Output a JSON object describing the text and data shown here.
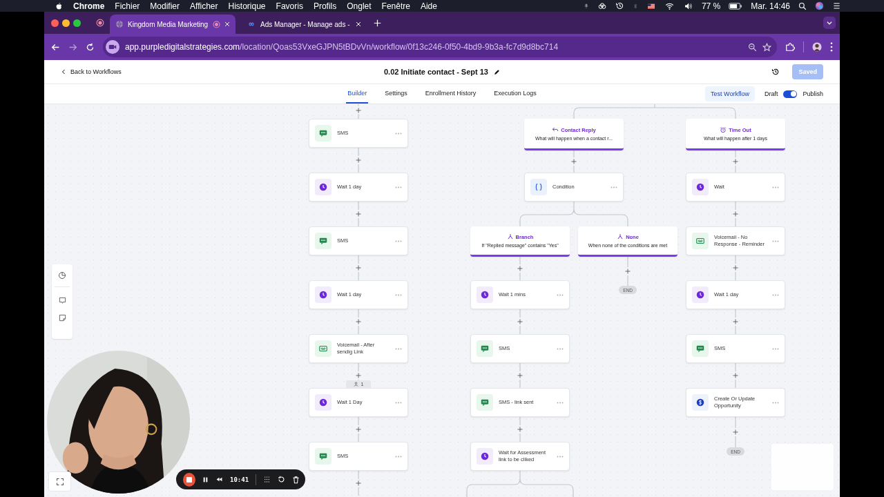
{
  "menu_bar": {
    "app": "Chrome",
    "menus": [
      "Fichier",
      "Modifier",
      "Afficher",
      "Historique",
      "Favoris",
      "Profils",
      "Onglet",
      "Fenêtre",
      "Aide"
    ],
    "battery": "77 %",
    "clock": "Mar. 14:46"
  },
  "browser": {
    "tabs": [
      {
        "title": "Kingdom Media Marketing",
        "selected": true,
        "recording": true,
        "kind": "globe"
      },
      {
        "title": "Ads Manager - Manage ads -",
        "selected": false,
        "recording": false,
        "kind": "meta"
      }
    ],
    "url": {
      "host": "app.purpledigitalstrategies.com",
      "path": "/location/Qoas53VxeGJPN5tBDvVn/workflow/0f13c246-0f50-4bd9-9b3a-fc7d9d8bc714"
    }
  },
  "header": {
    "back": "Back to Workflows",
    "title": "0.02 Initiate contact - Sept 13",
    "save_button": {
      "label": "Saved",
      "disabled": true
    }
  },
  "nav": {
    "tabs": [
      {
        "label": "Builder",
        "selected": true
      },
      {
        "label": "Settings",
        "selected": false
      },
      {
        "label": "Enrollment History",
        "selected": false
      },
      {
        "label": "Execution Logs",
        "selected": false
      }
    ],
    "test_button": "Test Workflow",
    "toggle": {
      "off_label": "Draft",
      "on_label": "Publish",
      "on": true
    }
  },
  "workflow": {
    "main_path": [
      {
        "kind": "sms",
        "label": "SMS"
      },
      {
        "kind": "wait",
        "label": "Wait 1 day"
      },
      {
        "kind": "sms",
        "label": "SMS"
      },
      {
        "kind": "wait",
        "label": "Wait 1 day"
      },
      {
        "kind": "voicemail",
        "label": "Voicemail - After sendig Link"
      },
      {
        "kind": "wait",
        "label": "Wait 1 Day",
        "contacts": "1"
      },
      {
        "kind": "sms",
        "label": "SMS"
      }
    ],
    "reply_path": {
      "kind": "reply",
      "title": "Contact Reply",
      "subtitle": "What will happen when a contact r...",
      "steps": [
        {
          "kind": "condition",
          "label": "Condition"
        }
      ],
      "branches": [
        {
          "title": "Branch",
          "subtitle": "If \"Replied message\" contains \"Yes\"",
          "steps": [
            {
              "kind": "wait",
              "label": "Wait 1 mins"
            },
            {
              "kind": "sms",
              "label": "SMS"
            },
            {
              "kind": "sms",
              "label": "SMS - link sent"
            },
            {
              "kind": "wait",
              "label": "Wait for Assessment link to be cliked"
            }
          ]
        },
        {
          "title": "None",
          "subtitle": "When none of the conditions are met",
          "end_label": "END"
        }
      ]
    },
    "timeout_path": {
      "kind": "timeout",
      "title": "Time Out",
      "subtitle": "What will happen after 1 days",
      "end_label": "END",
      "steps": [
        {
          "kind": "wait",
          "label": "Wait"
        },
        {
          "kind": "voicemail",
          "label": "Voicemail - No Response - Reminder"
        },
        {
          "kind": "wait",
          "label": "Wait 1 day"
        },
        {
          "kind": "sms",
          "label": "SMS"
        },
        {
          "kind": "opportunity",
          "label": "Create Or Update Opportunity"
        }
      ]
    }
  },
  "recorder": {
    "time": "10:41"
  }
}
